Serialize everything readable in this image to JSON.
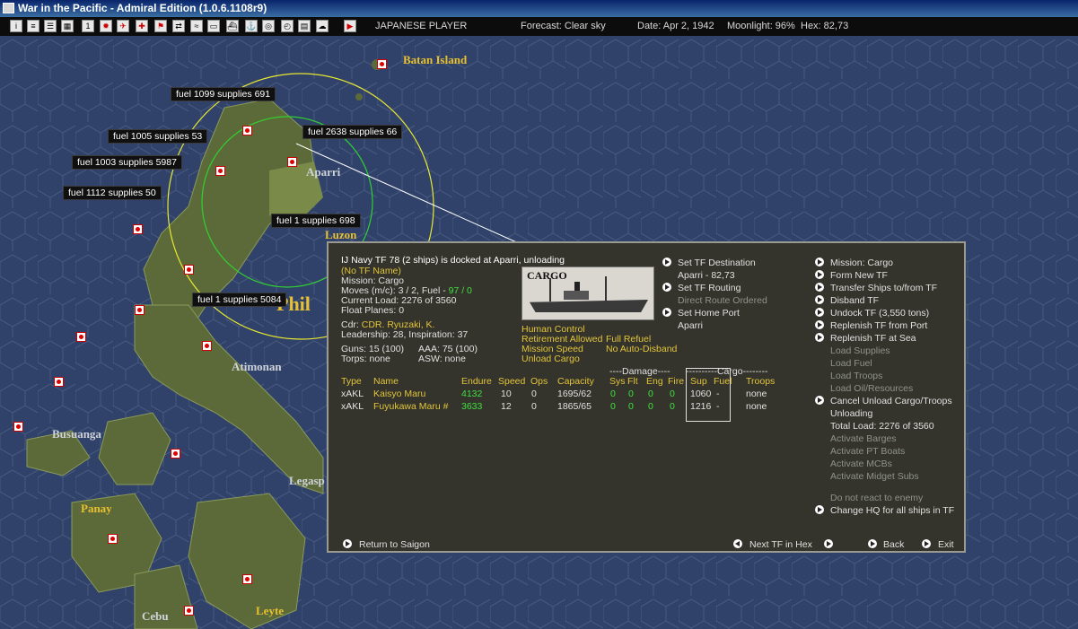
{
  "window": {
    "title": "War in the Pacific - Admiral Edition (1.0.6.1108r9)"
  },
  "toolbar": {
    "player": "JAPANESE PLAYER",
    "forecast": "Forecast: Clear sky",
    "date": "Date: Apr 2, 1942",
    "moonlight": "Moonlight: 96%",
    "hex": "Hex: 82,73"
  },
  "map": {
    "labels": {
      "batan": "Batan Island",
      "aparri": "Aparri",
      "luzon": "Luzon",
      "phil": "Phil",
      "atimonan": "Atimonan",
      "busuanga": "Busuanga",
      "legasp": "Legasp",
      "panay": "Panay",
      "cebu": "Cebu",
      "leyte": "Leyte"
    },
    "supplies": [
      "fuel 1099 supplies 691",
      "fuel 1005 supplies 53",
      "fuel 2638 supplies 66",
      "fuel 1003 supplies 5987",
      "fuel 1112 supplies 50",
      "fuel 1  supplies 698",
      "fuel 1  supplies 5084"
    ]
  },
  "tf": {
    "header": "IJ Navy TF 78 (2 ships) is docked at Aparri, unloading",
    "name": "(No TF Name)",
    "mission": "Mission: Cargo",
    "moves_prefix": "Moves (m/c): 3 / 2, Fuel - ",
    "moves_fuel": "97 / 0",
    "current_load": "Current Load: 2276 of 3560",
    "float_planes": "Float Planes: 0",
    "cdr_label": "Cdr:",
    "cdr_name": "CDR. Ryuzaki, K.",
    "leadership": "Leadership: 28, Inspiration: 37",
    "guns": "Guns: 15 (100)",
    "aaa": "AAA: 75 (100)",
    "torps": "Torps: none",
    "asw": "ASW: none",
    "image_label": "CARGO",
    "status": {
      "human_control": "Human Control",
      "retirement": "Retirement Allowed",
      "full_refuel": "Full Refuel",
      "mission_speed": "Mission Speed",
      "no_auto_disband": "No Auto-Disband",
      "unload_cargo": "Unload Cargo"
    },
    "routing": {
      "set_destination": "Set TF Destination",
      "destination": "Aparri - 82,73",
      "set_routing": "Set TF Routing",
      "direct_route": "Direct Route Ordered",
      "set_home_port": "Set Home Port",
      "home_port": "Aparri"
    },
    "table": {
      "group_damage": "----Damage----",
      "group_cargo": "----------Cargo--------",
      "headers": [
        "Type",
        "Name",
        "Endure",
        "Speed",
        "Ops",
        "Capacity",
        "Sys",
        "Flt",
        "Eng",
        "Fire",
        "Sup",
        "Fuel",
        "Troops"
      ],
      "rows": [
        [
          "xAKL",
          "Kaisyo Maru",
          "4132",
          "10",
          "0",
          "1695/62",
          "0",
          "0",
          "0",
          "0",
          "1060",
          "-",
          "none"
        ],
        [
          "xAKL",
          "Fuyukawa Maru #",
          "3633",
          "12",
          "0",
          "1865/65",
          "0",
          "0",
          "0",
          "0",
          "1216",
          "-",
          "none"
        ]
      ]
    },
    "actions": {
      "mission_cargo": "Mission: Cargo",
      "form_new_tf": "Form New TF",
      "transfer_ships": "Transfer Ships to/from TF",
      "disband_tf": "Disband TF",
      "undock_tf": "Undock TF (3,550 tons)",
      "replenish_port": "Replenish TF from Port",
      "replenish_sea": "Replenish TF at Sea",
      "load_supplies": "Load Supplies",
      "load_fuel": "Load Fuel",
      "load_troops": "Load Troops",
      "load_oil": "Load Oil/Resources",
      "cancel_unload": "Cancel Unload Cargo/Troops",
      "unloading": "Unloading",
      "total_load": "Total Load: 2276 of 3560",
      "activate_barges": "Activate Barges",
      "activate_pt": "Activate PT Boats",
      "activate_mcb": "Activate MCBs",
      "activate_midget": "Activate Midget Subs",
      "no_react": "Do not react to enemy",
      "change_hq": "Change HQ for all ships in TF"
    },
    "footer": {
      "return": "Return to Saigon",
      "next_tf": "Next TF in Hex",
      "back": "Back",
      "exit": "Exit"
    }
  },
  "colors": {
    "panel_bg": "#34342c",
    "sea": "#30426a",
    "highlight_yellow": "#e2c43a",
    "highlight_green": "#3fe03f"
  }
}
